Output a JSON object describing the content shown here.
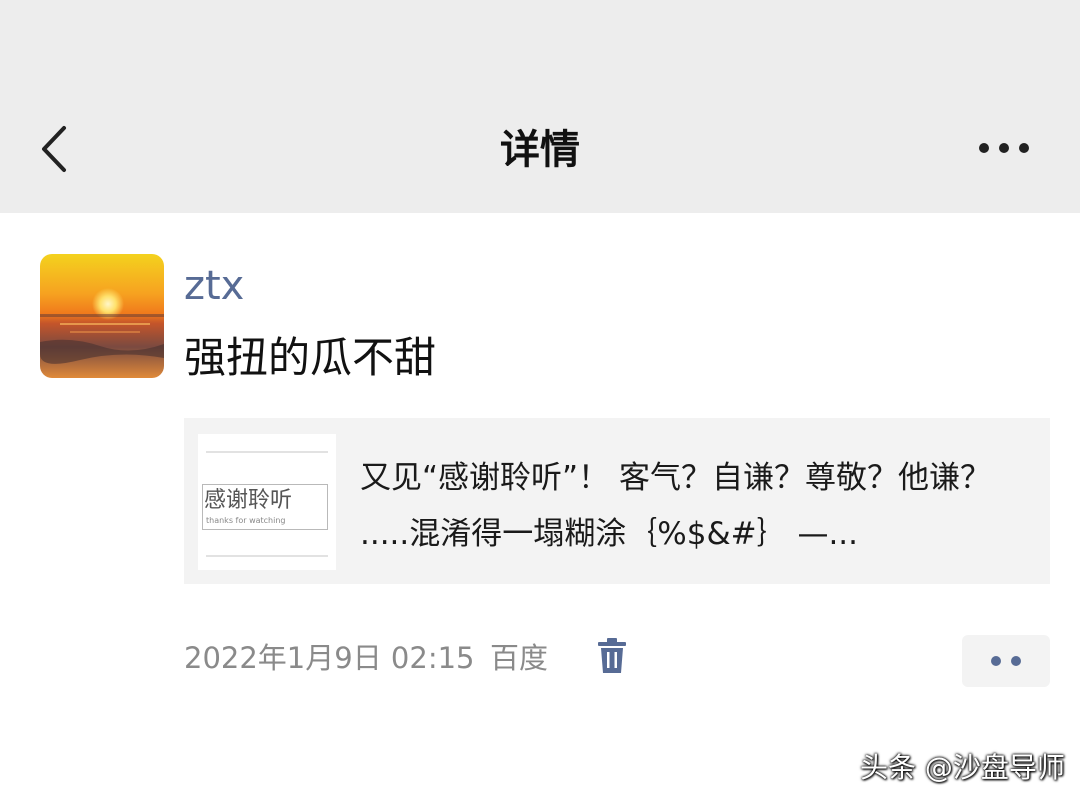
{
  "nav": {
    "back_icon": "chevron-left-icon",
    "title": "详情",
    "more_icon": "more-horizontal-icon"
  },
  "post": {
    "avatar": "sunset-avatar",
    "username": "ztx",
    "text": "强扭的瓜不甜",
    "link_card": {
      "thumbnail_text": "感谢聆听",
      "thumbnail_subtext": "thanks for watching",
      "title": "又见“感谢聆听”！ 客气？自谦？尊敬？他谦？ .....混淆得一塌糊涂｛%$&#｝ —..."
    },
    "timestamp": "2022年1月9日 02:15",
    "source": "百度",
    "delete_icon": "trash-icon",
    "action_icon": "two-dots-icon"
  },
  "watermark": "头条 @沙盘导师",
  "colors": {
    "navbar_bg": "#ededed",
    "username": "#576b95",
    "card_bg": "#f3f3f3",
    "meta_text": "#8a8a8a"
  }
}
